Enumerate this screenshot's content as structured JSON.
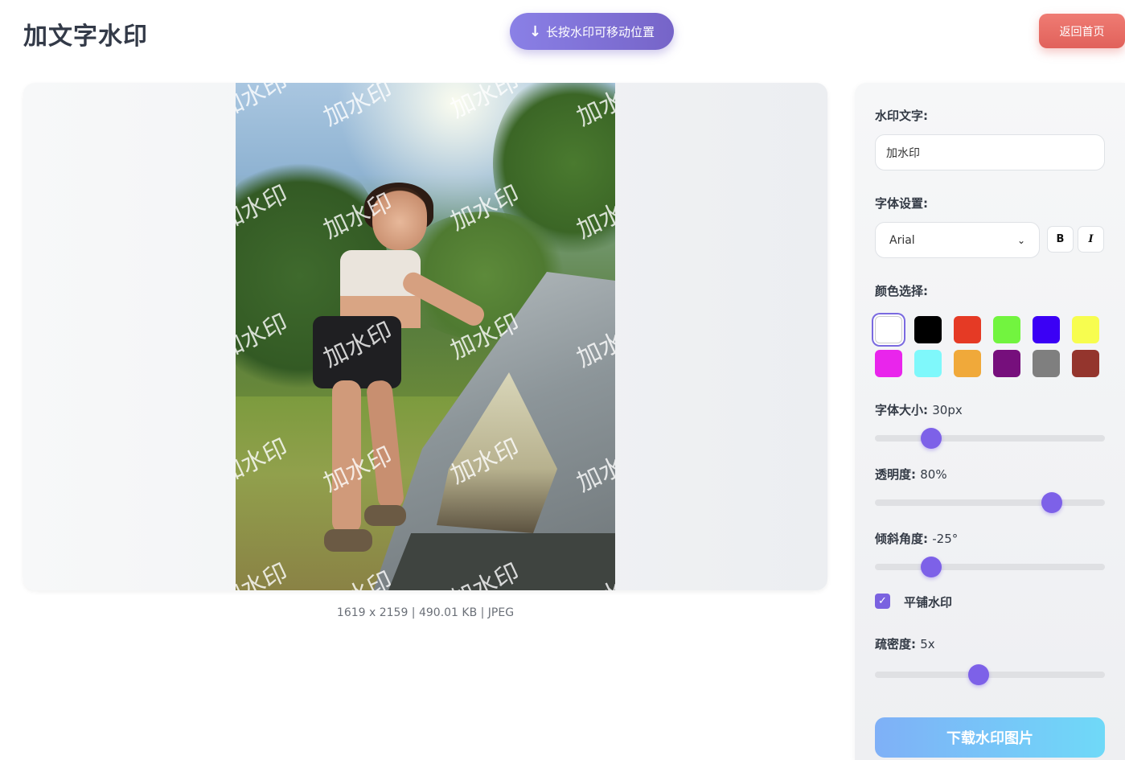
{
  "header": {
    "title": "加文字水印",
    "hint_arrow": "↓",
    "hint_text": "长按水印可移动位置",
    "home_label": "返回首页"
  },
  "preview": {
    "watermark_text": "加水印",
    "image_info": "1619 x 2159 | 490.01 KB | JPEG"
  },
  "controls": {
    "text_label": "水印文字:",
    "text_value": "加水印",
    "font_label": "字体设置:",
    "font_value": "Arial",
    "bold_label": "B",
    "italic_label": "I",
    "color_label": "颜色选择:",
    "colors": [
      "#ffffff",
      "#000000",
      "#e53a25",
      "#72f43f",
      "#3b00f5",
      "#f7fd4f",
      "#e925ec",
      "#7ff8fb",
      "#f0a93a",
      "#760f7c",
      "#7f7f7f",
      "#94352d"
    ],
    "selected_color": "#ffffff",
    "size_label": "字体大小:",
    "size_value": "30px",
    "size_fraction": 0.245,
    "opacity_label": "透明度:",
    "opacity_value": "80%",
    "opacity_fraction": 0.77,
    "angle_label": "倾斜角度:",
    "angle_value": "-25°",
    "angle_fraction": 0.245,
    "tile_label": "平铺水印",
    "tile_checked": true,
    "tile_check_glyph": "✓",
    "density_label": "疏密度:",
    "density_value": "5x",
    "density_fraction": 0.45,
    "download_label": "下载水印图片"
  }
}
